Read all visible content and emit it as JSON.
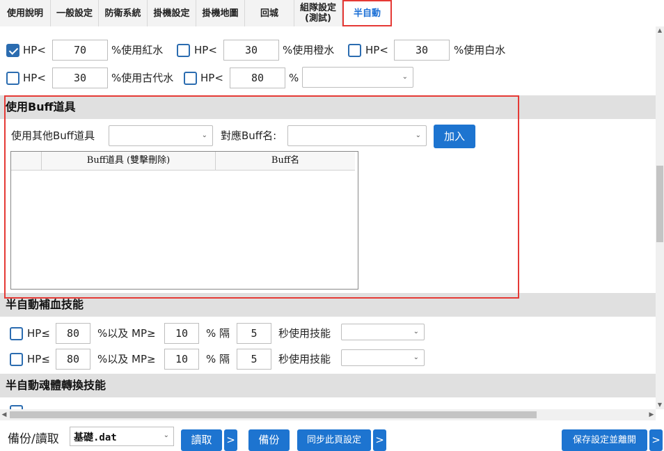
{
  "tabs": [
    {
      "label": "使用說明"
    },
    {
      "label": "一般設定"
    },
    {
      "label": "防衛系統"
    },
    {
      "label": "掛機設定"
    },
    {
      "label": "掛機地圖"
    },
    {
      "label": "回城"
    },
    {
      "label": "組隊設定\n(測試)"
    },
    {
      "label": "半自動",
      "active": true
    }
  ],
  "potion_section": {
    "rows": [
      [
        {
          "checked": true,
          "prefix": "HP<",
          "value": "70",
          "suffix": "%使用紅水"
        },
        {
          "checked": false,
          "prefix": "HP<",
          "value": "30",
          "suffix": "%使用橙水"
        },
        {
          "checked": false,
          "prefix": "HP<",
          "value": "30",
          "suffix": "%使用白水"
        }
      ],
      [
        {
          "checked": false,
          "prefix": "HP<",
          "value": "30",
          "suffix": "%使用古代水"
        },
        {
          "checked": false,
          "prefix": "HP<",
          "value": "80",
          "suffix": "%",
          "select_value": ""
        }
      ]
    ]
  },
  "buff_section": {
    "title": "使用Buff道具",
    "other_label": "使用其他Buff道具",
    "other_select_value": "",
    "buff_name_label": "對應Buff名:",
    "buff_name_select_value": "",
    "add_button": "加入",
    "table_headers": [
      "Buff道具 (雙擊刪除)",
      "Buff名"
    ]
  },
  "semi_heal_section": {
    "title": "半自動補血技能",
    "rows": [
      {
        "checked": false,
        "hp_label": "HP≤",
        "hp": "80",
        "mp_label": "%以及 MP≥",
        "mp": "10",
        "interval_label": "% 隔",
        "interval": "5",
        "skill_label": "秒使用技能",
        "skill_value": ""
      },
      {
        "checked": false,
        "hp_label": "HP≤",
        "hp": "80",
        "mp_label": "%以及 MP≥",
        "mp": "10",
        "interval_label": "% 隔",
        "interval": "5",
        "skill_label": "秒使用技能",
        "skill_value": ""
      }
    ]
  },
  "soul_section": {
    "title": "半自動魂體轉換技能"
  },
  "footer": {
    "backup_label": "備份/讀取",
    "file_value": "基礎.dat",
    "load_button": "讀取",
    "arrow": ">",
    "backup_button": "備份",
    "sync_button": "同步此頁設定",
    "save_exit_button": "保存設定並離開"
  },
  "colors": {
    "accent": "#1d74d0",
    "highlight_border": "#e53935",
    "section_bg": "#e0e0e0"
  }
}
